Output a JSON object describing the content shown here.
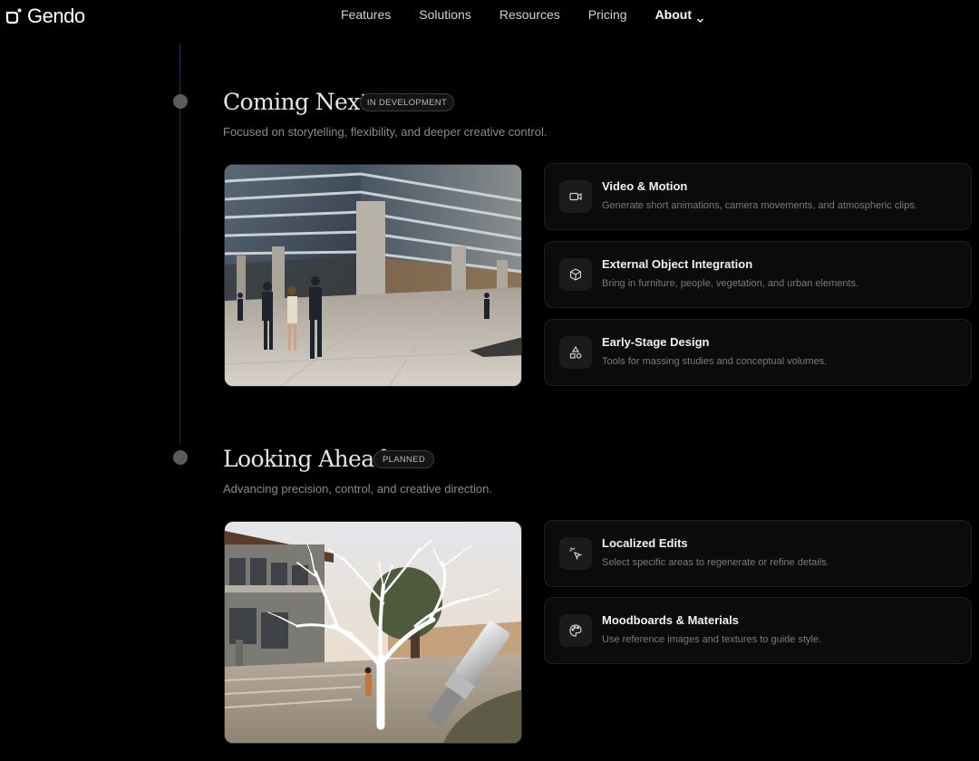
{
  "brand": {
    "name": "Gendo"
  },
  "nav": {
    "items": [
      {
        "label": "Features"
      },
      {
        "label": "Solutions"
      },
      {
        "label": "Resources"
      },
      {
        "label": "Pricing"
      },
      {
        "label": "About"
      }
    ]
  },
  "sections": [
    {
      "title": "Coming Next",
      "badge": "IN DEVELOPMENT",
      "subtitle": "Focused on storytelling, flexibility, and deeper creative control.",
      "features": [
        {
          "title": "Video & Motion",
          "description": "Generate short animations, camera movements, and atmospheric clips.",
          "icon": "video-camera-icon"
        },
        {
          "title": "External Object Integration",
          "description": "Bring in furniture, people, vegetation, and urban elements.",
          "icon": "cube-icon"
        },
        {
          "title": "Early-Stage Design",
          "description": "Tools for massing studies and conceptual volumes.",
          "icon": "shapes-icon"
        }
      ]
    },
    {
      "title": "Looking Ahead",
      "badge": "PLANNED",
      "subtitle": "Advancing precision, control, and creative direction.",
      "features": [
        {
          "title": "Localized Edits",
          "description": "Select specific areas to regenerate or refine details.",
          "icon": "cursor-click-icon"
        },
        {
          "title": "Moodboards & Materials",
          "description": "Use reference images and textures to guide style.",
          "icon": "palette-icon"
        }
      ]
    }
  ],
  "colors": {
    "background": "#000000",
    "card_background": "#0b0b0b",
    "card_border": "#1f1f1f",
    "timeline_dot": "#5b5b5b",
    "muted_text": "#8a8a8a"
  }
}
